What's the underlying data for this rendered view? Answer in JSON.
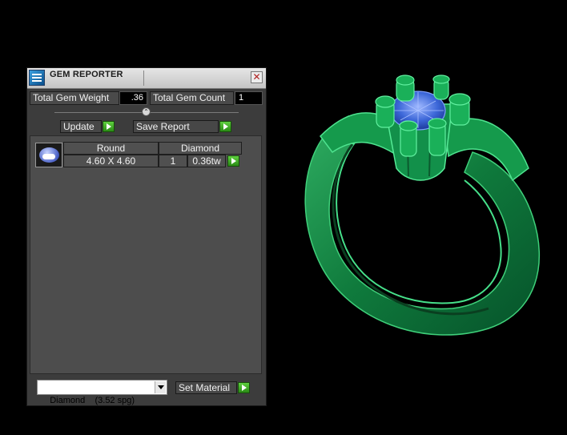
{
  "panel": {
    "title": "GEM REPORTER",
    "close_symbol": "✕",
    "total_weight_label": "Total Gem Weight",
    "total_weight_value": ".36",
    "total_count_label": "Total Gem Count",
    "total_count_value": "1",
    "update_label": "Update",
    "save_report_label": "Save Report",
    "table": {
      "col_shape": "Round",
      "col_material": "Diamond",
      "row": {
        "size": "4.60 X 4.60",
        "count": "1",
        "weight": "0.36tw"
      }
    },
    "material_select": "Diamond    (3.52 spg)",
    "set_material_label": "Set Material"
  },
  "colors": {
    "ring_green": "#0f7a3c",
    "gem_blue": "#3c67d8",
    "panel_bg": "#3c3c3c"
  },
  "icons": [
    "gem-reporter-app-icon",
    "close-icon",
    "collapse-knob-icon",
    "play-arrow-icon",
    "round-gem-thumbnail-icon",
    "dropdown-arrow-icon"
  ]
}
